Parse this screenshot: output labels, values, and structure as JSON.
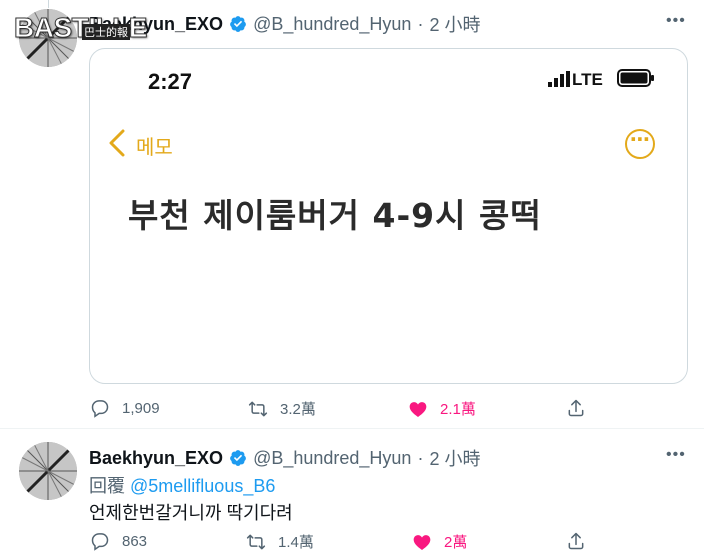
{
  "watermark": {
    "text": "BASTILLE",
    "sub": "巴士的報"
  },
  "tweet1": {
    "name": "Baekhyun_EXO",
    "handle": "@B_hundred_Hyun",
    "dot": "·",
    "time": "2 小時",
    "more": "•••",
    "image": {
      "status_time": "2:27",
      "network": "LTE",
      "back_label": "메모",
      "more_glyph": "⋯",
      "note_text": "부천 제이룸버거 4-9시 콩떡"
    },
    "actions": {
      "replies": "1,909",
      "retweets": "3.2萬",
      "likes": "2.1萬"
    }
  },
  "tweet2": {
    "name": "Baekhyun_EXO",
    "handle": "@B_hundred_Hyun",
    "dot": "·",
    "time": "2 小時",
    "more": "•••",
    "reply_prefix": "回覆 ",
    "reply_mention": "@5mellifluous_B6",
    "text": "언제한번갈거니까 딱기다려",
    "actions": {
      "replies": "863",
      "retweets": "1.4萬",
      "likes": "2萬"
    }
  },
  "colors": {
    "accent": "#1d9bf0",
    "like": "#f91880",
    "memo": "#e3a91a",
    "muted": "#536471"
  }
}
